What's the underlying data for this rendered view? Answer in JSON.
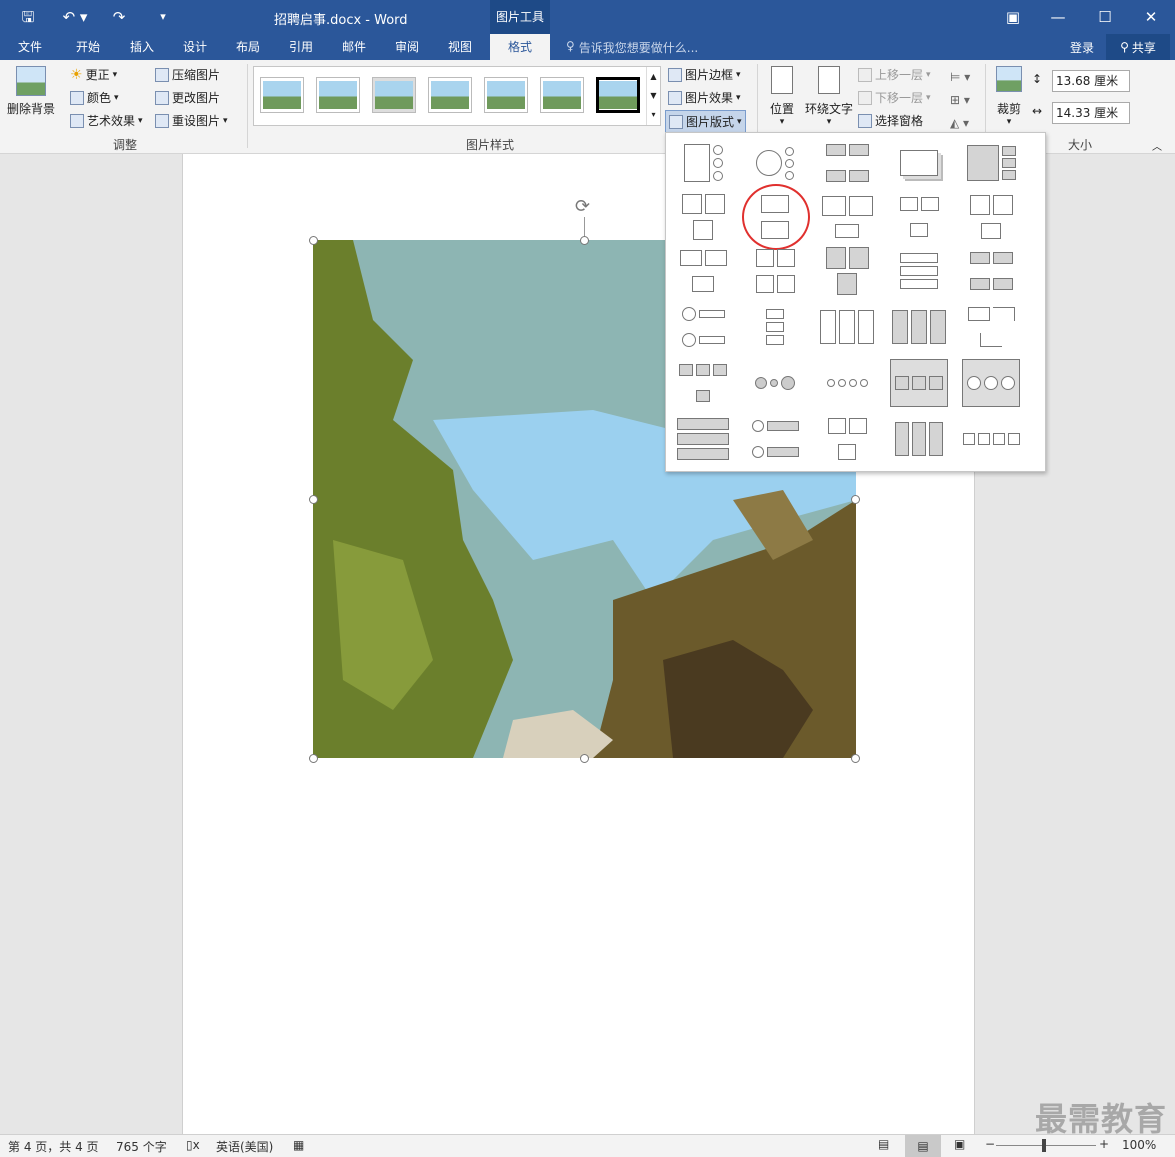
{
  "title_bar": {
    "doc_title": "招聘启事.docx - Word",
    "tool_tab": "图片工具"
  },
  "tabs": [
    {
      "label": "文件"
    },
    {
      "label": "开始"
    },
    {
      "label": "插入"
    },
    {
      "label": "设计"
    },
    {
      "label": "布局"
    },
    {
      "label": "引用"
    },
    {
      "label": "邮件"
    },
    {
      "label": "审阅"
    },
    {
      "label": "视图"
    },
    {
      "label": "格式"
    }
  ],
  "tell_me": "告诉我您想要做什么...",
  "account": {
    "login": "登录",
    "share": "共享"
  },
  "ribbon": {
    "remove_bg": "删除背景",
    "adjust": {
      "correct": "更正",
      "color": "颜色",
      "artistic": "艺术效果",
      "compress": "压缩图片",
      "change": "更改图片",
      "reset": "重设图片",
      "group": "调整"
    },
    "styles": {
      "group": "图片样式",
      "border": "图片边框",
      "effects": "图片效果",
      "layout": "图片版式"
    },
    "arrange": {
      "position": "位置",
      "wrap": "环绕文字",
      "forward": "上移一层",
      "backward": "下移一层",
      "selection_pane": "选择窗格"
    },
    "size": {
      "crop": "裁剪",
      "height": "13.68 厘米",
      "width": "14.33 厘米",
      "group": "大小"
    }
  },
  "status": {
    "page": "第 4 页，共 4 页",
    "words": "765 个字",
    "lang": "英语(美国)",
    "zoom": "100%"
  },
  "watermark": "最需教育"
}
